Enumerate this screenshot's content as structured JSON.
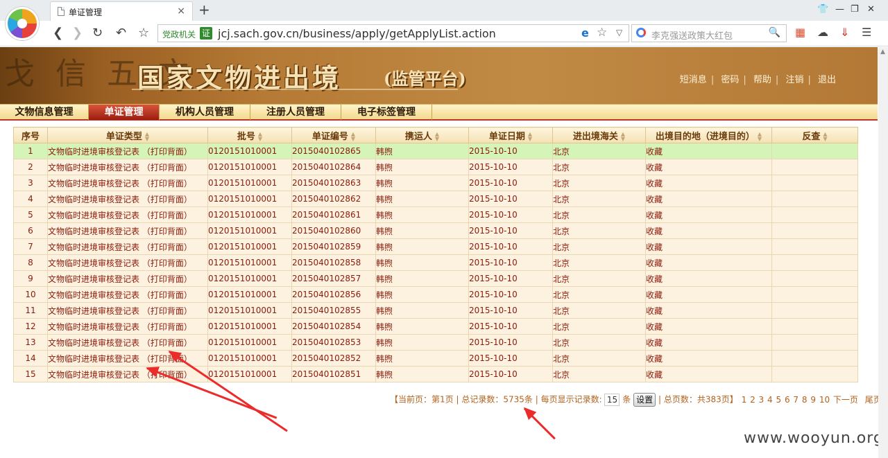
{
  "browser": {
    "tab_title": "单证管理",
    "tab_close": "×",
    "new_tab": "+",
    "gov_tag": "党政机关",
    "gov_badge": "证",
    "url": "jcj.sach.gov.cn/business/apply/getApplyList.action",
    "search_placeholder": "李克强送政策大红包"
  },
  "header": {
    "site_title": "国家文物进出境",
    "site_subtitle": "(监管平台)",
    "decor_glyphs": "戈 信 五 文",
    "links": [
      "短消息",
      "密码",
      "帮助",
      "注销",
      "退出"
    ]
  },
  "menu": [
    "文物信息管理",
    "单证管理",
    "机构人员管理",
    "注册人员管理",
    "电子标签管理"
  ],
  "table": {
    "headers": [
      "序号",
      "单证类型",
      "批号",
      "单证编号",
      "携运人",
      "单证日期",
      "进出境海关",
      "出境目的地（进境目的）",
      "反查"
    ],
    "rows": [
      [
        "1",
        "文物临时进境审核登记表 （打印背面）",
        "0120151010001",
        "2015040102865",
        "韩煦",
        "2015-10-10",
        "北京",
        "收藏",
        ""
      ],
      [
        "2",
        "文物临时进境审核登记表 （打印背面）",
        "0120151010001",
        "2015040102864",
        "韩煦",
        "2015-10-10",
        "北京",
        "收藏",
        ""
      ],
      [
        "3",
        "文物临时进境审核登记表 （打印背面）",
        "0120151010001",
        "2015040102863",
        "韩煦",
        "2015-10-10",
        "北京",
        "收藏",
        ""
      ],
      [
        "4",
        "文物临时进境审核登记表 （打印背面）",
        "0120151010001",
        "2015040102862",
        "韩煦",
        "2015-10-10",
        "北京",
        "收藏",
        ""
      ],
      [
        "5",
        "文物临时进境审核登记表 （打印背面）",
        "0120151010001",
        "2015040102861",
        "韩煦",
        "2015-10-10",
        "北京",
        "收藏",
        ""
      ],
      [
        "6",
        "文物临时进境审核登记表 （打印背面）",
        "0120151010001",
        "2015040102860",
        "韩煦",
        "2015-10-10",
        "北京",
        "收藏",
        ""
      ],
      [
        "7",
        "文物临时进境审核登记表 （打印背面）",
        "0120151010001",
        "2015040102859",
        "韩煦",
        "2015-10-10",
        "北京",
        "收藏",
        ""
      ],
      [
        "8",
        "文物临时进境审核登记表 （打印背面）",
        "0120151010001",
        "2015040102858",
        "韩煦",
        "2015-10-10",
        "北京",
        "收藏",
        ""
      ],
      [
        "9",
        "文物临时进境审核登记表 （打印背面）",
        "0120151010001",
        "2015040102857",
        "韩煦",
        "2015-10-10",
        "北京",
        "收藏",
        ""
      ],
      [
        "10",
        "文物临时进境审核登记表 （打印背面）",
        "0120151010001",
        "2015040102856",
        "韩煦",
        "2015-10-10",
        "北京",
        "收藏",
        ""
      ],
      [
        "11",
        "文物临时进境审核登记表 （打印背面）",
        "0120151010001",
        "2015040102855",
        "韩煦",
        "2015-10-10",
        "北京",
        "收藏",
        ""
      ],
      [
        "12",
        "文物临时进境审核登记表 （打印背面）",
        "0120151010001",
        "2015040102854",
        "韩煦",
        "2015-10-10",
        "北京",
        "收藏",
        ""
      ],
      [
        "13",
        "文物临时进境审核登记表 （打印背面）",
        "0120151010001",
        "2015040102853",
        "韩煦",
        "2015-10-10",
        "北京",
        "收藏",
        ""
      ],
      [
        "14",
        "文物临时进境审核登记表 （打印背面）",
        "0120151010001",
        "2015040102852",
        "韩煦",
        "2015-10-10",
        "北京",
        "收藏",
        ""
      ],
      [
        "15",
        "文物临时进境审核登记表 （打印背面）",
        "0120151010001",
        "2015040102851",
        "韩煦",
        "2015-10-10",
        "北京",
        "收藏",
        ""
      ]
    ]
  },
  "pager": {
    "current": "【当前页：第1页",
    "total_records": "总记录数：5735条",
    "per_page_label": "每页显示记录数:",
    "per_page_value": "15",
    "per_page_unit": "条",
    "set_button": "设置",
    "total_pages": "总页数：共383页】",
    "pages": [
      "1",
      "2",
      "3",
      "4",
      "5",
      "6",
      "7",
      "8",
      "9",
      "10"
    ],
    "next": "下一页",
    "last": "尾页"
  },
  "watermark": "www.wooyun.org"
}
